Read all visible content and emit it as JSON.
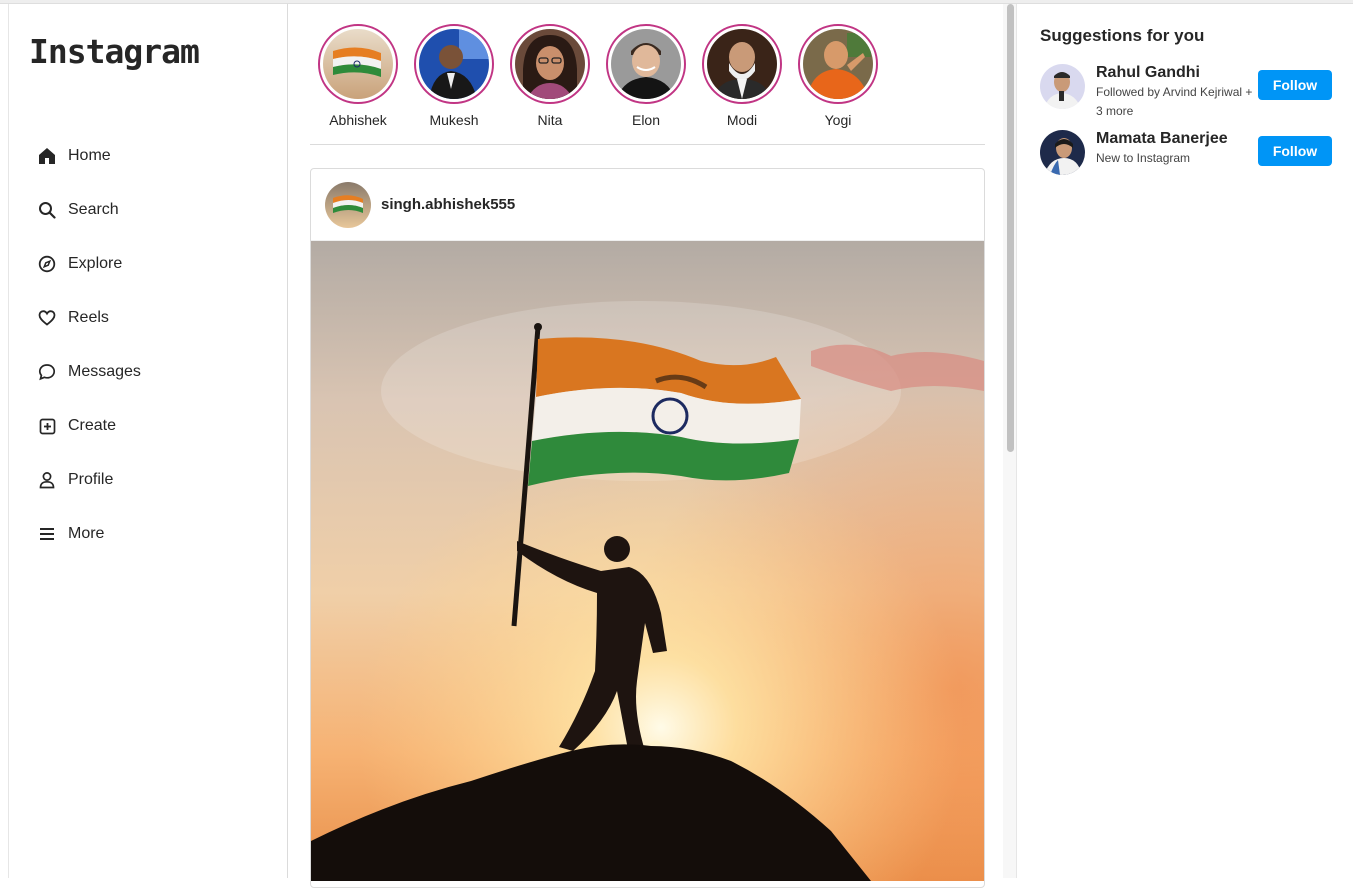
{
  "app": {
    "logo": "Instagram"
  },
  "sidebar": {
    "items": [
      {
        "label": "Home",
        "icon": "home-icon"
      },
      {
        "label": "Search",
        "icon": "search-icon"
      },
      {
        "label": "Explore",
        "icon": "compass-icon"
      },
      {
        "label": "Reels",
        "icon": "heart-icon"
      },
      {
        "label": "Messages",
        "icon": "chat-bubble-icon"
      },
      {
        "label": "Create",
        "icon": "plus-square-icon"
      },
      {
        "label": "Profile",
        "icon": "user-icon"
      },
      {
        "label": "More",
        "icon": "menu-icon"
      }
    ]
  },
  "stories": [
    {
      "name": "Abhishek"
    },
    {
      "name": "Mukesh"
    },
    {
      "name": "Nita"
    },
    {
      "name": "Elon"
    },
    {
      "name": "Modi"
    },
    {
      "name": "Yogi"
    }
  ],
  "post": {
    "username": "singh.abhishek555"
  },
  "suggestions": {
    "title": "Suggestions for you",
    "users": [
      {
        "name": "Rahul Gandhi",
        "subtitle": "Followed by Arvind Kejriwal + 3 more",
        "button": "Follow"
      },
      {
        "name": "Mamata Banerjee",
        "subtitle": "New to Instagram",
        "button": "Follow"
      }
    ]
  },
  "colors": {
    "accent": "#0095f6",
    "story_ring": "#c13584"
  }
}
